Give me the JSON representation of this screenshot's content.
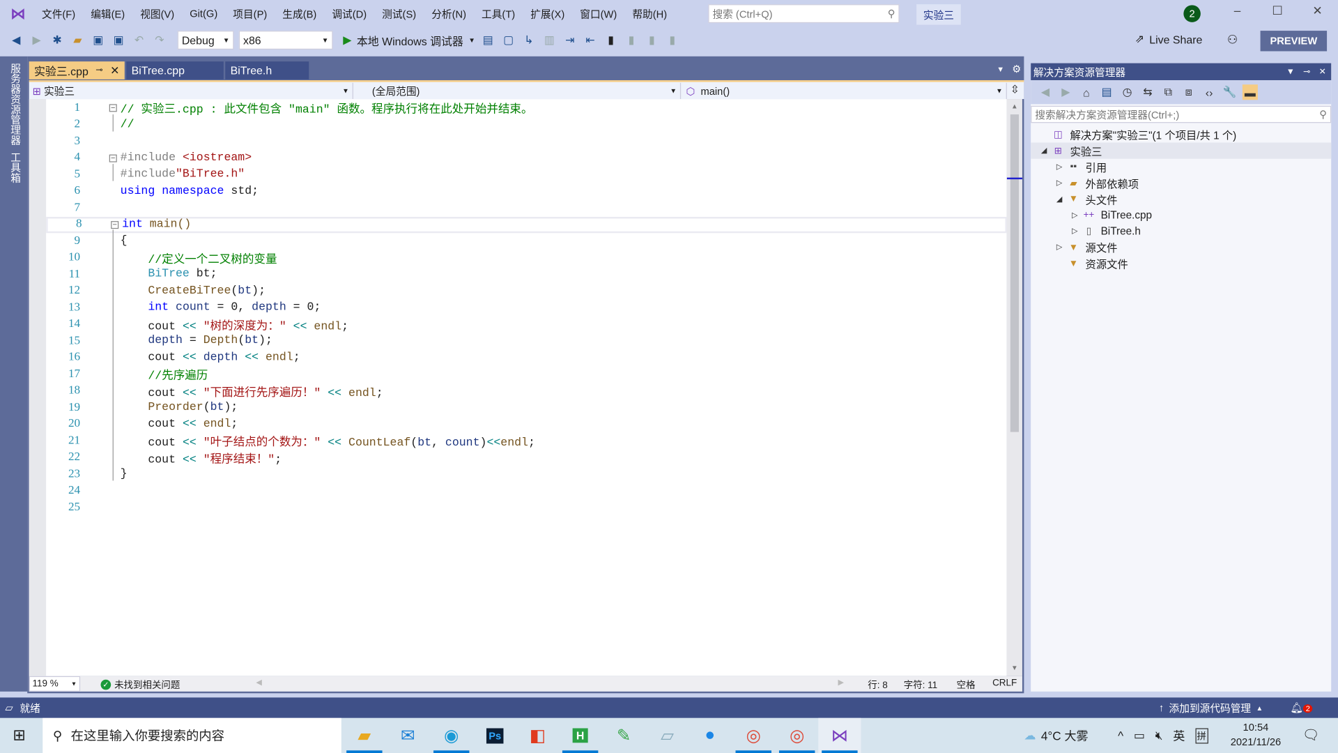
{
  "menubar": {
    "items": [
      "文件(F)",
      "编辑(E)",
      "视图(V)",
      "Git(G)",
      "项目(P)",
      "生成(B)",
      "调试(D)",
      "测试(S)",
      "分析(N)",
      "工具(T)",
      "扩展(X)",
      "窗口(W)",
      "帮助(H)"
    ],
    "search_placeholder": "搜索 (Ctrl+Q)",
    "project_name": "实验三",
    "notification_count": "2"
  },
  "toolbar": {
    "config": "Debug",
    "platform": "x86",
    "run_label": "本地 Windows 调试器",
    "live_share": "Live Share",
    "preview": "PREVIEW"
  },
  "left_tabs": [
    "服务器资源管理器",
    "工具箱"
  ],
  "tabs": [
    {
      "label": "实验三.cpp",
      "active": true
    },
    {
      "label": "BiTree.cpp"
    },
    {
      "label": "BiTree.h"
    }
  ],
  "navbar": {
    "project": "实验三",
    "scope": "(全局范围)",
    "member": "main()"
  },
  "code": [
    [
      [
        "// 实验三.cpp : 此文件包含 \"main\" 函数。程序执行将在此处开始并结束。",
        "c"
      ]
    ],
    [
      [
        "//",
        "c"
      ]
    ],
    [],
    [
      [
        "#include ",
        "p"
      ],
      [
        "<iostream>",
        "s"
      ]
    ],
    [
      [
        "#include",
        "p"
      ],
      [
        "\"BiTree.h\"",
        "s"
      ]
    ],
    [
      [
        "using",
        "k"
      ],
      [
        " ",
        "d"
      ],
      [
        "namespace",
        "k"
      ],
      [
        " std;",
        "d"
      ]
    ],
    [],
    [
      [
        "int",
        "k"
      ],
      [
        " main()",
        "f"
      ]
    ],
    [
      [
        "{",
        "d"
      ]
    ],
    [
      [
        "    //定义一个二叉树的变量",
        "c"
      ]
    ],
    [
      [
        "    BiTree",
        "t"
      ],
      [
        " bt;",
        "d"
      ]
    ],
    [
      [
        "    CreateBiTree",
        "f"
      ],
      [
        "(",
        "d"
      ],
      [
        "bt",
        "v"
      ],
      [
        ");",
        "d"
      ]
    ],
    [
      [
        "    int",
        "k"
      ],
      [
        " count",
        "v"
      ],
      [
        " = 0, ",
        "d"
      ],
      [
        "depth",
        "v"
      ],
      [
        " = 0;",
        "d"
      ]
    ],
    [
      [
        "    cout ",
        "d"
      ],
      [
        "<<",
        "o"
      ],
      [
        " ",
        "d"
      ],
      [
        "\"树的深度为：\"",
        "s"
      ],
      [
        " ",
        "d"
      ],
      [
        "<<",
        "o"
      ],
      [
        " endl",
        "f"
      ],
      [
        ";",
        "d"
      ]
    ],
    [
      [
        "    depth",
        "v"
      ],
      [
        " = ",
        "d"
      ],
      [
        "Depth",
        "f"
      ],
      [
        "(",
        "d"
      ],
      [
        "bt",
        "v"
      ],
      [
        ");",
        "d"
      ]
    ],
    [
      [
        "    cout ",
        "d"
      ],
      [
        "<<",
        "o"
      ],
      [
        " depth ",
        "v"
      ],
      [
        "<<",
        "o"
      ],
      [
        " endl",
        "f"
      ],
      [
        ";",
        "d"
      ]
    ],
    [
      [
        "    //先序遍历",
        "c"
      ]
    ],
    [
      [
        "    cout ",
        "d"
      ],
      [
        "<<",
        "o"
      ],
      [
        " ",
        "d"
      ],
      [
        "\"下面进行先序遍历！\"",
        "s"
      ],
      [
        " ",
        "d"
      ],
      [
        "<<",
        "o"
      ],
      [
        " endl",
        "f"
      ],
      [
        ";",
        "d"
      ]
    ],
    [
      [
        "    Preorder",
        "f"
      ],
      [
        "(",
        "d"
      ],
      [
        "bt",
        "v"
      ],
      [
        ");",
        "d"
      ]
    ],
    [
      [
        "    cout ",
        "d"
      ],
      [
        "<<",
        "o"
      ],
      [
        " endl",
        "f"
      ],
      [
        ";",
        "d"
      ]
    ],
    [
      [
        "    cout ",
        "d"
      ],
      [
        "<<",
        "o"
      ],
      [
        " ",
        "d"
      ],
      [
        "\"叶子结点的个数为：\"",
        "s"
      ],
      [
        " ",
        "d"
      ],
      [
        "<<",
        "o"
      ],
      [
        " CountLeaf",
        "f"
      ],
      [
        "(",
        "d"
      ],
      [
        "bt",
        "v"
      ],
      [
        ", ",
        "d"
      ],
      [
        "count",
        "v"
      ],
      [
        ")",
        "d"
      ],
      [
        "<<",
        "o"
      ],
      [
        "endl",
        "f"
      ],
      [
        ";",
        "d"
      ]
    ],
    [
      [
        "    cout ",
        "d"
      ],
      [
        "<<",
        "o"
      ],
      [
        " ",
        "d"
      ],
      [
        "\"程序结束！\"",
        "s"
      ],
      [
        ";",
        "d"
      ]
    ],
    [
      [
        "}",
        "d"
      ]
    ],
    [],
    []
  ],
  "editor_status": {
    "zoom": "119 %",
    "issues": "未找到相关问题",
    "line": "行: 8",
    "char": "字符: 11",
    "spaces": "空格",
    "eol": "CRLF"
  },
  "solution_explorer": {
    "title": "解决方案资源管理器",
    "search_placeholder": "搜索解决方案资源管理器(Ctrl+;)",
    "items": [
      {
        "label": "解决方案\"实验三\"(1 个项目/共 1 个)",
        "icon": "solution-icon"
      },
      {
        "label": "实验三",
        "icon": "cpp-project-icon",
        "expanded": true
      },
      {
        "label": "引用",
        "icon": "references-icon"
      },
      {
        "label": "外部依赖项",
        "icon": "folder-icon"
      },
      {
        "label": "头文件",
        "icon": "filter-folder-icon",
        "expanded": true
      },
      {
        "label": "BiTree.cpp",
        "icon": "cpp-file-icon"
      },
      {
        "label": "BiTree.h",
        "icon": "header-file-icon"
      },
      {
        "label": "源文件",
        "icon": "filter-folder-icon"
      },
      {
        "label": "资源文件",
        "icon": "filter-folder-icon"
      }
    ]
  },
  "statusbar": {
    "ready": "就绪",
    "source_control": "添加到源代码管理",
    "bell_count": "2"
  },
  "taskbar": {
    "search_placeholder": "在这里输入你要搜索的内容",
    "weather": "4°C 大雾",
    "ime_lang": "英",
    "ime_mode": "拼",
    "time": "10:54",
    "date": "2021/11/26"
  }
}
